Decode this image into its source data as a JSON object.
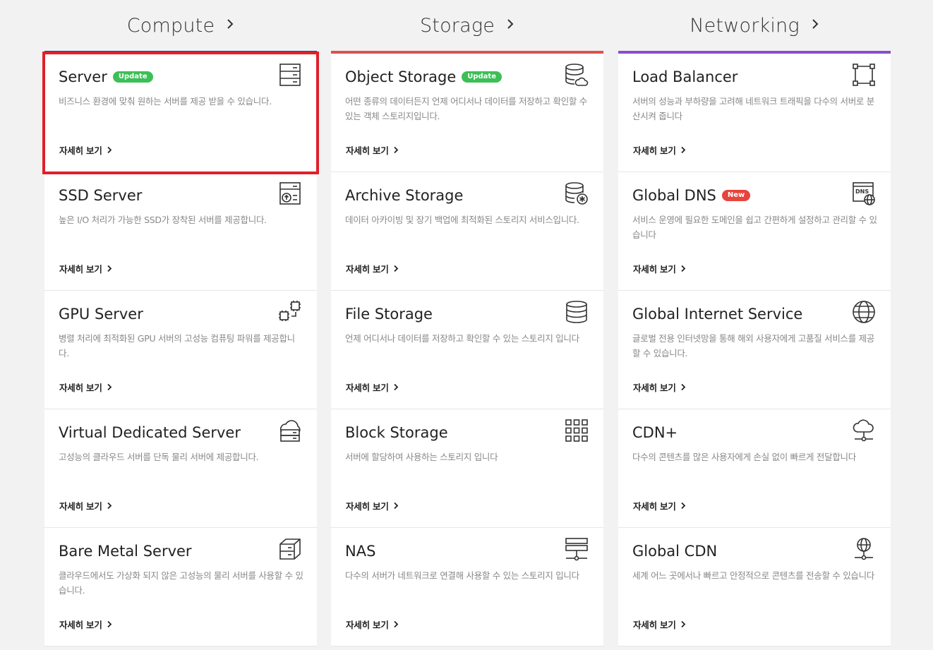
{
  "columns": [
    {
      "label": "Compute",
      "color": "#3b3f86",
      "cards": [
        {
          "title": "Server",
          "badge": "Update",
          "badge_type": "update",
          "icon": "server-rack-icon",
          "desc": "비즈니스 환경에 맞춰 원하는 서버를 제공 받을 수 있습니다.",
          "more": "자세히 보기"
        },
        {
          "title": "SSD Server",
          "badge": "",
          "icon": "ssd-server-icon",
          "desc": "높은 I/O 처리가 가능한 SSD가 장착된 서버를 제공합니다.",
          "more": "자세히 보기"
        },
        {
          "title": "GPU Server",
          "badge": "",
          "icon": "gpu-chip-icon",
          "desc": "병렬 처리에 최적화된 GPU 서버의 고성능 컴퓨팅 파워를 제공합니다.",
          "more": "자세히 보기"
        },
        {
          "title": "Virtual Dedicated Server",
          "badge": "",
          "icon": "cloud-server-icon",
          "desc": "고성능의 클라우드 서버를 단독 물리 서버에 제공합니다.",
          "more": "자세히 보기"
        },
        {
          "title": "Bare Metal Server",
          "badge": "",
          "icon": "bare-metal-box-icon",
          "desc": "클라우드에서도 가상화 되지 않은 고성능의 물리 서버를 사용할 수 있습니다.",
          "more": "자세히 보기"
        }
      ]
    },
    {
      "label": "Storage",
      "color": "#d9534f",
      "cards": [
        {
          "title": "Object Storage",
          "badge": "Update",
          "badge_type": "update",
          "icon": "database-cloud-icon",
          "desc": "어떤 종류의 데이터든지 언제 어디서나 데이터를 저장하고 확인할 수 있는 객체 스토리지입니다.",
          "more": "자세히 보기"
        },
        {
          "title": "Archive Storage",
          "badge": "",
          "icon": "database-archive-icon",
          "desc": "데이터 아카이빙 및 장기 백업에 최적화된 스토리지 서비스입니다.",
          "more": "자세히 보기"
        },
        {
          "title": "File Storage",
          "badge": "",
          "icon": "database-icon",
          "desc": "언제 어디서나 데이터를 저장하고 확인할 수 있는 스토리지 입니다",
          "more": "자세히 보기"
        },
        {
          "title": "Block Storage",
          "badge": "",
          "icon": "blocks-grid-icon",
          "desc": "서버에 할당하여 사용하는 스토리지 입니다",
          "more": "자세히 보기"
        },
        {
          "title": "NAS",
          "badge": "",
          "icon": "nas-network-icon",
          "desc": "다수의 서버가 네트워크로 연결해 사용할 수 있는 스토리지 입니다",
          "more": "자세히 보기"
        }
      ]
    },
    {
      "label": "Networking",
      "color": "#8a4fc9",
      "cards": [
        {
          "title": "Load Balancer",
          "badge": "",
          "icon": "load-balancer-icon",
          "desc": "서버의 성능과 부하량을 고려해 네트워크 트래픽을 다수의 서버로 분산시켜 줍니다",
          "more": "자세히 보기"
        },
        {
          "title": "Global DNS",
          "badge": "New",
          "badge_type": "new",
          "icon": "dns-globe-icon",
          "desc": "서비스 운영에 필요한 도메인을 쉽고 간편하게 설정하고 관리할 수 있습니다",
          "more": "자세히 보기"
        },
        {
          "title": "Global Internet Service",
          "badge": "",
          "icon": "globe-icon",
          "desc": "글로벌 전용 인터넷망을 통해 해외 사용자에게 고품질 서비스를 제공할 수 있습니다.",
          "more": "자세히 보기"
        },
        {
          "title": "CDN+",
          "badge": "",
          "icon": "cloud-network-icon",
          "desc": "다수의 콘텐츠를 많은 사용자에게 손실 없이 빠르게 전달합니다",
          "more": "자세히 보기"
        },
        {
          "title": "Global CDN",
          "badge": "",
          "icon": "globe-network-icon",
          "desc": "세계 어느 곳에서나 빠르고 안정적으로 콘텐츠를 전송할 수 있습니다",
          "more": "자세히 보기"
        }
      ]
    }
  ]
}
